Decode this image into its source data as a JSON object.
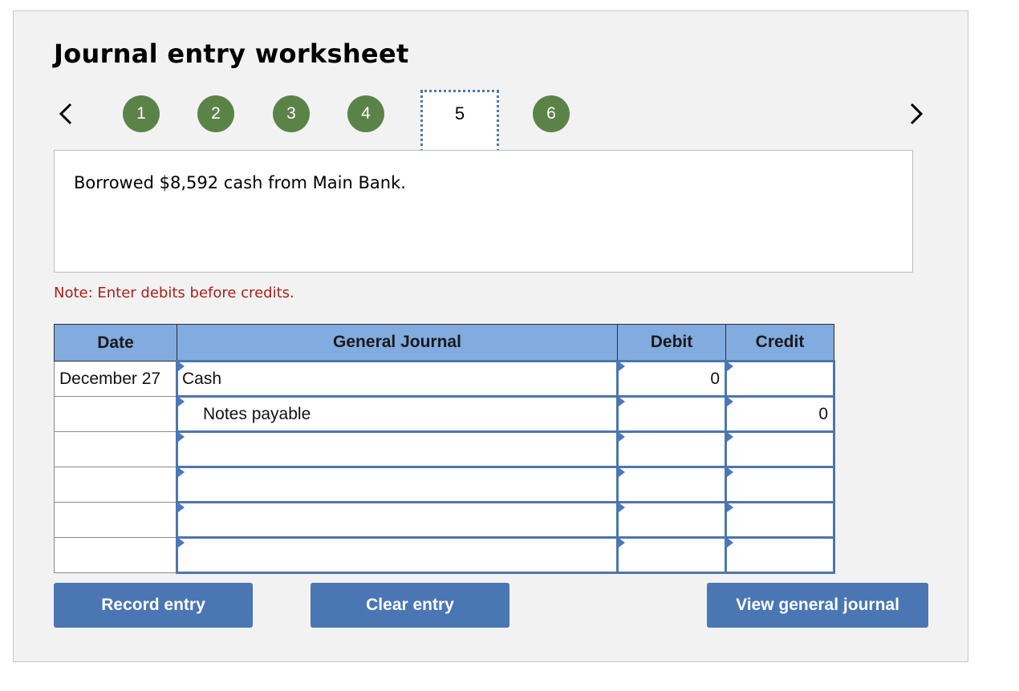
{
  "header": {
    "title": "Journal entry worksheet"
  },
  "nav": {
    "prev_icon": "chevron-left-icon",
    "next_icon": "chevron-right-icon",
    "steps": [
      {
        "label": "1",
        "state": "completed"
      },
      {
        "label": "2",
        "state": "completed"
      },
      {
        "label": "3",
        "state": "completed"
      },
      {
        "label": "4",
        "state": "completed"
      },
      {
        "label": "5",
        "state": "current"
      },
      {
        "label": "6",
        "state": "completed"
      }
    ],
    "step_color": "#5b8348"
  },
  "prompt": {
    "text": "Borrowed $8,592 cash from Main Bank."
  },
  "note": {
    "text": "Note: Enter debits before credits.",
    "color": "#a8201a"
  },
  "table": {
    "headers": {
      "date": "Date",
      "general_journal": "General Journal",
      "debit": "Debit",
      "credit": "Credit"
    },
    "header_color": "#82abe0",
    "rows": [
      {
        "date": "December 27",
        "account": "Cash",
        "indent": false,
        "debit": "0",
        "credit": ""
      },
      {
        "date": "",
        "account": "Notes payable",
        "indent": true,
        "debit": "",
        "credit": "0"
      },
      {
        "date": "",
        "account": "",
        "indent": false,
        "debit": "",
        "credit": ""
      },
      {
        "date": "",
        "account": "",
        "indent": false,
        "debit": "",
        "credit": ""
      },
      {
        "date": "",
        "account": "",
        "indent": false,
        "debit": "",
        "credit": ""
      },
      {
        "date": "",
        "account": "",
        "indent": false,
        "debit": "",
        "credit": ""
      }
    ]
  },
  "buttons": {
    "record": "Record entry",
    "clear": "Clear entry",
    "view": "View general journal",
    "color": "#4a76b4"
  }
}
